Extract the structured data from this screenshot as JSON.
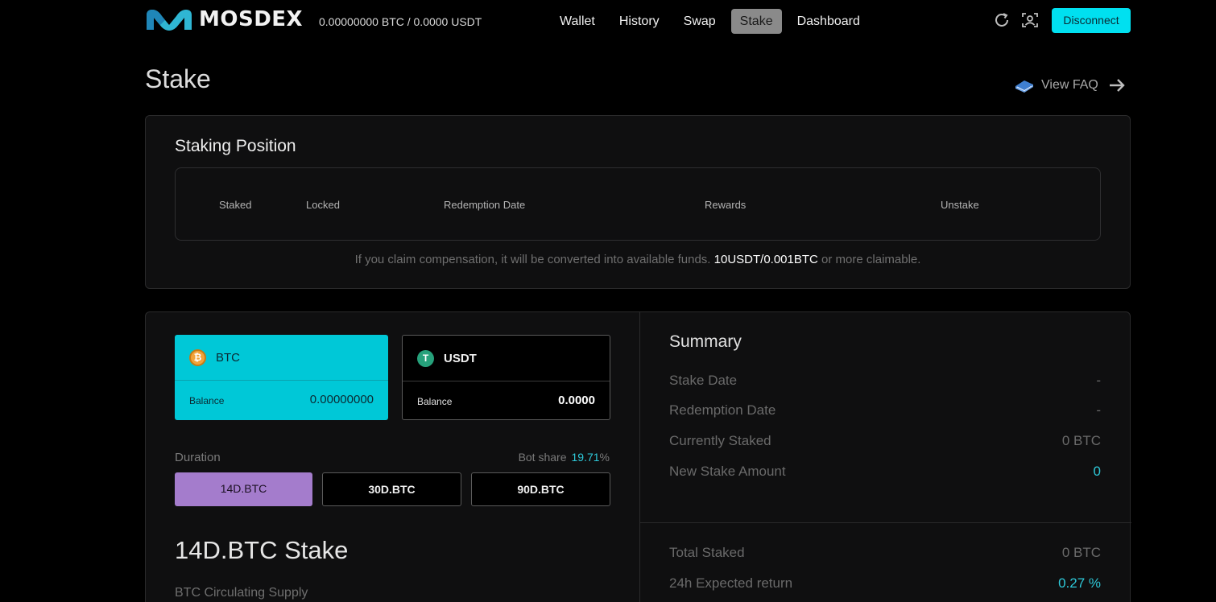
{
  "header": {
    "brand": "MOSDEX",
    "wallet_balance": "0.00000000 BTC / 0.0000 USDT",
    "nav": [
      {
        "label": "Wallet",
        "active": false
      },
      {
        "label": "History",
        "active": false
      },
      {
        "label": "Swap",
        "active": false
      },
      {
        "label": "Stake",
        "active": true
      },
      {
        "label": "Dashboard",
        "active": false
      }
    ],
    "icons": [
      "refresh-icon",
      "face-id-icon"
    ],
    "disconnect_label": "Disconnect"
  },
  "page": {
    "title": "Stake",
    "faq_label": "View FAQ"
  },
  "staking_position": {
    "title": "Staking Position",
    "columns": [
      "Staked",
      "Locked",
      "Redemption Date",
      "Rewards",
      "Unstake"
    ],
    "note_prefix": "If you claim compensation, it will be converted into available funds. ",
    "note_highlight": "10USDT/0.001BTC",
    "note_suffix": " or more claimable."
  },
  "stake_form": {
    "tokens": [
      {
        "symbol": "BTC",
        "balance_label": "Balance",
        "balance": "0.00000000",
        "selected": true
      },
      {
        "symbol": "USDT",
        "balance_label": "Balance",
        "balance": "0.0000",
        "selected": false
      }
    ],
    "duration_label": "Duration",
    "bot_share_label": "Bot share",
    "bot_share_value": "19.71",
    "bot_share_unit": "%",
    "durations": [
      {
        "label": "14D.BTC",
        "selected": true
      },
      {
        "label": "30D.BTC",
        "selected": false
      },
      {
        "label": "90D.BTC",
        "selected": false
      }
    ],
    "stake_title": "14D.BTC Stake",
    "supply_label": "BTC Circulating Supply"
  },
  "summary": {
    "title": "Summary",
    "rows": [
      {
        "label": "Stake Date",
        "value": "-"
      },
      {
        "label": "Redemption Date",
        "value": "-"
      },
      {
        "label": "Currently Staked",
        "value": "0 BTC"
      },
      {
        "label": "New Stake Amount",
        "value": "0"
      }
    ],
    "totals": [
      {
        "label": "Total Staked",
        "value": "0 BTC"
      },
      {
        "label": "24h Expected return",
        "value": "0.27 %"
      }
    ]
  },
  "colors": {
    "accent_cyan": "#00e0f0",
    "selected_token": "#00c8d7",
    "selected_duration": "#a47ccc",
    "highlight_value": "#2ec8d8"
  }
}
